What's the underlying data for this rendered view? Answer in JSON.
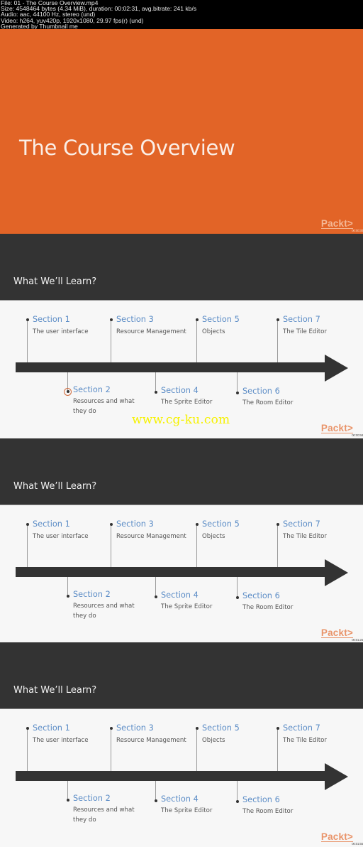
{
  "file_info": {
    "lines": [
      "File: 01 - The Course Overview.mp4",
      "Size: 4548464 bytes (4.34 MiB), duration: 00:02:31, avg.bitrate: 241 kb/s",
      "Audio: aac, 44100 Hz, stereo (und)",
      "Video: h264, yuv420p, 1920x1080, 29.97 fps(r) (und)",
      "Generated by Thumbnail me"
    ]
  },
  "title_slide": {
    "title": "The Course Overview",
    "logo": "Packt>",
    "timestamp": "00:00:30"
  },
  "frames": [
    {
      "heading": "What We’ll Learn?",
      "logo": "Packt>",
      "timestamp": "00:00:58",
      "watermark": "www.cg-ku.com",
      "highlight": "section-2"
    },
    {
      "heading": "What We’ll Learn?",
      "logo": "Packt>",
      "timestamp": "00:01:25"
    },
    {
      "heading": "What We’ll Learn?",
      "logo": "Packt>",
      "timestamp": "00:01:55"
    }
  ],
  "sections": [
    {
      "title": "Section 1",
      "desc": [
        "The user interface"
      ]
    },
    {
      "title": "Section 2",
      "desc": [
        "Resources and what",
        "they do"
      ]
    },
    {
      "title": "Section 3",
      "desc": [
        "Resource Management"
      ]
    },
    {
      "title": "Section 4",
      "desc": [
        "The Sprite Editor"
      ]
    },
    {
      "title": "Section 5",
      "desc": [
        "Objects"
      ]
    },
    {
      "title": "Section 6",
      "desc": [
        "The Room Editor"
      ]
    },
    {
      "title": "Section 7",
      "desc": [
        "The Tile Editor"
      ]
    }
  ],
  "colors": {
    "orange": "#e26427",
    "dark": "#333333",
    "section_blue": "#5b8cc6",
    "watermark_yellow": "#f6f200"
  }
}
